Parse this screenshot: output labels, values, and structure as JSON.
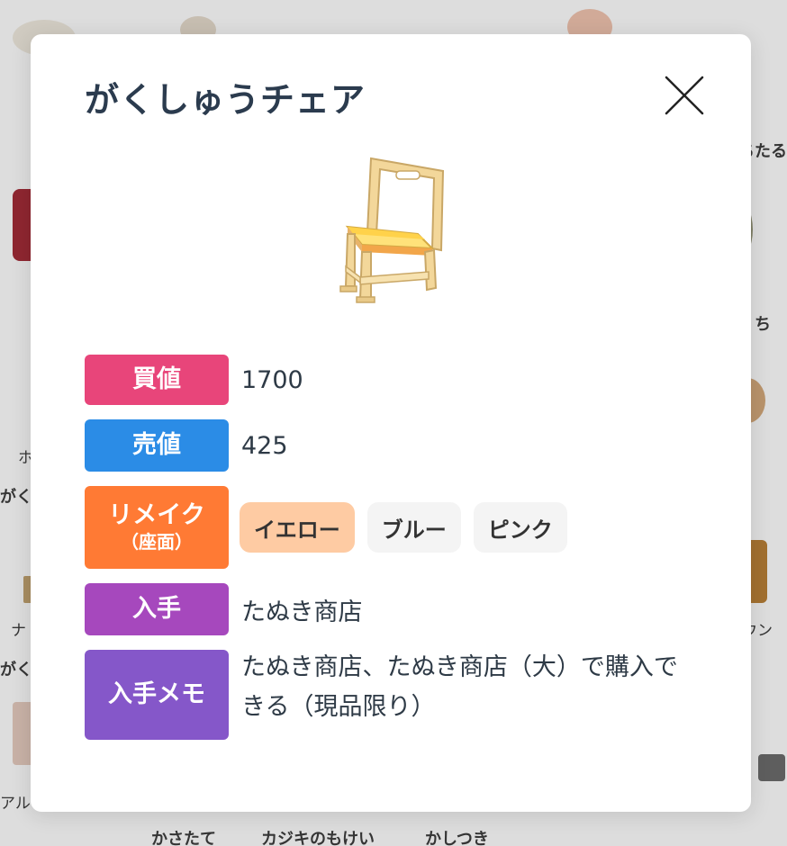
{
  "background": {
    "texts": [
      "かさたて",
      "カジキのもけい",
      "かしつき",
      "がく",
      "がく",
      "ホ",
      "ナ",
      "アルフ",
      "ちたる",
      "ち",
      "ウン"
    ]
  },
  "modal": {
    "title": "がくしゅうチェア",
    "rows": {
      "buy": {
        "label": "買値",
        "value": "1700",
        "color": "#e8457a"
      },
      "sell": {
        "label": "売値",
        "value": "425",
        "color": "#2b8ce6"
      },
      "remake": {
        "label": "リメイク",
        "sublabel": "（座面）",
        "color": "#ff7a34",
        "options": [
          "イエロー",
          "ブルー",
          "ピンク"
        ],
        "selected_color": "#fecba3"
      },
      "source": {
        "label": "入手",
        "value": "たぬき商店",
        "color": "#a648bd"
      },
      "memo": {
        "label": "入手メモ",
        "value": "たぬき商店、たぬき商店（大）で購入できる（現品限り）",
        "color": "#8557c9"
      }
    }
  },
  "icons": {
    "close": "close-icon",
    "item": "chair-image"
  }
}
